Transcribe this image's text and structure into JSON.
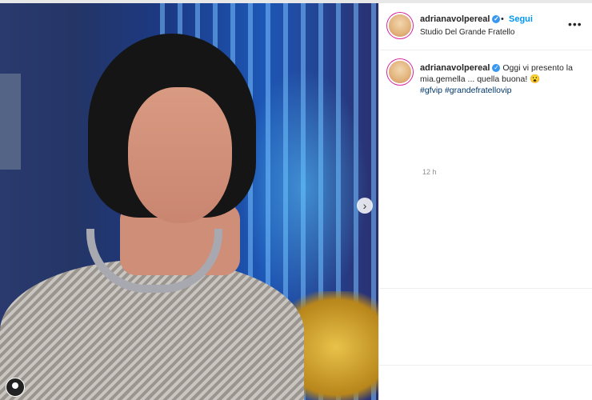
{
  "post": {
    "username": "adrianavolpereal",
    "verified_glyph": "✓",
    "separator": "•",
    "follow_label": "Segui",
    "location": "Studio Del Grande Fratello",
    "more_glyph": "•••",
    "caption_text": "Oggi vi presento la mia.gemella ... quella buona! 😮",
    "hashtags": [
      "#gfvip",
      "#grandefratellovip"
    ],
    "time_ago": "12 h",
    "next_glyph": "›"
  },
  "icons": [
    "verified-badge-icon",
    "more-options-icon",
    "next-arrow-icon",
    "user-tag-icon"
  ],
  "colors": {
    "follow": "#0095f6",
    "hashtag": "#00376b",
    "verified": "#3897f0",
    "muted": "#8e8e8e"
  }
}
